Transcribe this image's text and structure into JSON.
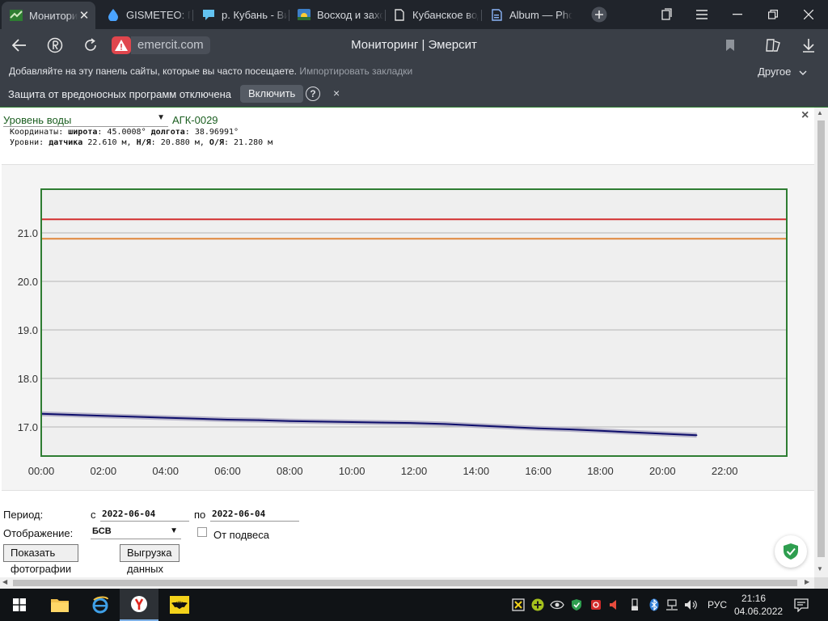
{
  "browser": {
    "tabs": [
      {
        "label": "Мониторинг | Эмерсит",
        "icon": "emercit-logo-icon",
        "active": true
      },
      {
        "label": "GISMETEO: Погода",
        "icon": "gismeteo-drop-icon"
      },
      {
        "label": "р. Кубань - Википедия",
        "icon": "speech-bubble-icon"
      },
      {
        "label": "Восход и заход солнца",
        "icon": "sunrise-icon"
      },
      {
        "label": "Кубанское водохранилище",
        "icon": "document-icon"
      },
      {
        "label": "Album — Photos",
        "icon": "album-icon"
      }
    ],
    "address": {
      "domain": "emercit.com",
      "page_title": "Мониторинг | Эмерсит"
    },
    "bookmarks_bar": {
      "hint": "Добавляйте на эту панель сайты, которые вы часто посещаете.",
      "import_link": "Импортировать закладки",
      "other": "Другое"
    },
    "security_bar": {
      "message": "Защита от вредоносных программ отключена",
      "enable_button": "Включить",
      "help": "?",
      "close": "×"
    }
  },
  "panel": {
    "close": "×",
    "parameter": "Уровень воды",
    "station": "АГК-0029",
    "coords": {
      "label": "Координаты:",
      "lat_label": "широта",
      "lat": ": 45.0008°",
      "lon_label": "долгота",
      "lon": ": 38.96991°"
    },
    "levels": {
      "label": "Уровни:",
      "sensor_label": "датчика",
      "sensor": " 22.610 м,",
      "nya_label": "Н/Я",
      "nya": ": 20.880 м,",
      "oya_label": "О/Я",
      "oya": ": 21.280 м"
    }
  },
  "chart_data": {
    "type": "line",
    "x_ticks": [
      "00:00",
      "02:00",
      "04:00",
      "06:00",
      "08:00",
      "10:00",
      "12:00",
      "14:00",
      "16:00",
      "18:00",
      "20:00",
      "22:00"
    ],
    "y_ticks": [
      "17.0",
      "18.0",
      "19.0",
      "20.0",
      "21.0"
    ],
    "xlim_hours": [
      0,
      24
    ],
    "ylim": [
      16.4,
      21.9
    ],
    "grid": true,
    "thresholds": [
      {
        "value": 21.28,
        "color": "#d32f2f"
      },
      {
        "value": 20.88,
        "color": "#e0863a"
      }
    ],
    "series": [
      {
        "color": "#0d0d6b",
        "x_hours": [
          0,
          1,
          2,
          3,
          4,
          5,
          6,
          7,
          8,
          9,
          10,
          11,
          12,
          13,
          14,
          15,
          16,
          17,
          18,
          19,
          20,
          21.1
        ],
        "y": [
          17.27,
          17.25,
          17.23,
          17.21,
          17.19,
          17.17,
          17.15,
          17.14,
          17.12,
          17.11,
          17.1,
          17.09,
          17.08,
          17.06,
          17.03,
          17.0,
          16.97,
          16.95,
          16.92,
          16.89,
          16.86,
          16.83
        ]
      }
    ]
  },
  "form": {
    "period_label": "Период:",
    "from_label": "с",
    "from_value": "2022-06-04",
    "to_label": "по",
    "to_value": "2022-06-04",
    "display_label": "Отображение:",
    "display_value": "БСВ",
    "from_mount_label": "От подвеса",
    "photos_button": "Показать фотографии",
    "export_button": "Выгрузка данных"
  },
  "taskbar": {
    "lang": "РУС",
    "time": "21:16",
    "date": "04.06.2022"
  },
  "colors": {
    "accent_green": "#2e7d32",
    "line": "#0d0d6b",
    "danger": "#d32f2f",
    "warning": "#e0863a"
  }
}
